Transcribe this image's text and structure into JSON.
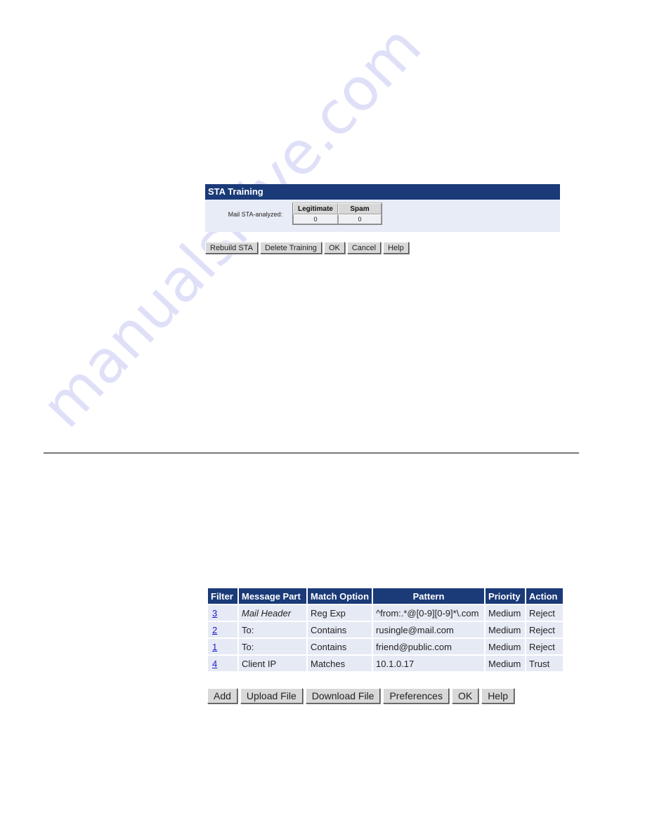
{
  "sta_training": {
    "title": "STA Training",
    "row_label": "Mail STA-analyzed:",
    "columns": [
      "Legitimate",
      "Spam"
    ],
    "values": [
      "0",
      "0"
    ],
    "buttons": [
      "Rebuild STA",
      "Delete Training",
      "OK",
      "Cancel",
      "Help"
    ]
  },
  "filters": {
    "columns": [
      "Filter",
      "Message Part",
      "Match Option",
      "Pattern",
      "Priority",
      "Action"
    ],
    "rows": [
      {
        "filter": "3",
        "message_part": "Mail Header",
        "match_option": "Reg Exp",
        "pattern": "^from:.*@[0-9][0-9]*\\.com",
        "priority": "Medium",
        "action": "Reject"
      },
      {
        "filter": "2",
        "message_part": "To:",
        "match_option": "Contains",
        "pattern": "rusingle@mail.com",
        "priority": "Medium",
        "action": "Reject"
      },
      {
        "filter": "1",
        "message_part": "To:",
        "match_option": "Contains",
        "pattern": "friend@public.com",
        "priority": "Medium",
        "action": "Reject"
      },
      {
        "filter": "4",
        "message_part": "Client IP",
        "match_option": "Matches",
        "pattern": "10.1.0.17",
        "priority": "Medium",
        "action": "Trust"
      }
    ],
    "buttons": [
      "Add",
      "Upload File",
      "Download File",
      "Preferences",
      "OK",
      "Help"
    ]
  },
  "watermark": "manualshive.com",
  "colors": {
    "header_blue": "#1a3a78",
    "row_bg": "#e6eaf4",
    "link": "#1a1acc"
  }
}
